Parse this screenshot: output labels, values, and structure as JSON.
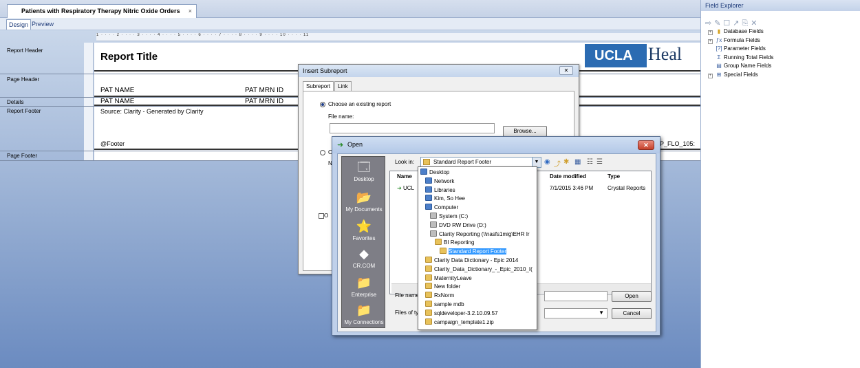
{
  "app": {
    "doc_tab": "Patients with Respiratory Therapy Nitric Oxide Orders",
    "doc_tab_close": "×",
    "mode_tabs": [
      "Design",
      "Preview"
    ]
  },
  "ruler": {
    "marks": "1 · · · · 2 · · · · 3 · · · · 4 · · · · 5 · · · · 6 · · · · 7 · · · · 8 · · · · 9 · · · · 10 · · · · 11"
  },
  "sections": [
    "Report Header",
    "Page Header",
    "Details",
    "Report Footer",
    "Page Footer"
  ],
  "report": {
    "title": "Report Title",
    "logo_text": "UCLA",
    "logo_suffix": "Heal",
    "page_header_fields": [
      "PAT NAME",
      "PAT MRN ID"
    ],
    "details_fields": [
      "PAT NAME",
      "PAT MRN ID"
    ],
    "footer_source": "Source: Clarity - Generated by Clarity",
    "footer_formula": "@Footer",
    "clipped_field": "P_FLO_105:"
  },
  "insert_subreport": {
    "title": "Insert Subreport",
    "close": "✕",
    "tabs": [
      "Subreport",
      "Link"
    ],
    "option_existing": "Choose an existing report",
    "file_name_label": "File name:",
    "file_name_value": "",
    "browse": "Browse...",
    "option_create_partial": "C",
    "option_partial_2": "N",
    "checkbox_partial": "O"
  },
  "open_dialog": {
    "title": "Open",
    "close": "✕",
    "look_in_label": "Look in:",
    "look_in_value": "Standard Report Footer",
    "places": [
      "Desktop",
      "My Documents",
      "Favorites",
      "CR.COM",
      "Enterprise",
      "My Connections"
    ],
    "columns": {
      "name": "Name",
      "date": "Date modified",
      "type": "Type"
    },
    "file_row": {
      "name": "UCL",
      "date": "7/1/2015 3:46 PM",
      "type": "Crystal Reports"
    },
    "file_name_label": "File name",
    "files_of_type_label": "Files of typ",
    "open_button": "Open",
    "cancel_button": "Cancel"
  },
  "look_in_dropdown": [
    {
      "label": "Desktop",
      "icon": "desktop-icon",
      "indent": 0
    },
    {
      "label": "Network",
      "icon": "network-icon",
      "indent": 1
    },
    {
      "label": "Libraries",
      "icon": "libraries-icon",
      "indent": 1
    },
    {
      "label": "Kim, So Hee",
      "icon": "user-icon",
      "indent": 1
    },
    {
      "label": "Computer",
      "icon": "computer-icon",
      "indent": 1
    },
    {
      "label": "System (C:)",
      "icon": "drive-icon",
      "indent": 2
    },
    {
      "label": "DVD RW Drive (D:)",
      "icon": "dvd-icon",
      "indent": 2
    },
    {
      "label": "Clarity Reporting (\\\\nasfs1mig\\EHR Ir",
      "icon": "network-drive-icon",
      "indent": 2
    },
    {
      "label": "BI Reporting",
      "icon": "folder-icon",
      "indent": 3
    },
    {
      "label": "Standard Report Footer",
      "icon": "folder-icon",
      "indent": 4,
      "selected": true
    },
    {
      "label": "Clarity Data Dictionary - Epic 2014",
      "icon": "folder-icon",
      "indent": 1
    },
    {
      "label": "Clarity_Data_Dictionary_-_Epic_2010_I(",
      "icon": "folder-icon",
      "indent": 1
    },
    {
      "label": "MaternityLeave",
      "icon": "folder-icon",
      "indent": 1
    },
    {
      "label": "New folder",
      "icon": "folder-icon",
      "indent": 1
    },
    {
      "label": "RxNorm",
      "icon": "folder-icon",
      "indent": 1
    },
    {
      "label": "sample mdb",
      "icon": "folder-icon",
      "indent": 1
    },
    {
      "label": "sqldeveloper-3.2.10.09.57",
      "icon": "folder-icon",
      "indent": 1
    },
    {
      "label": "campaign_template1.zip",
      "icon": "zip-folder-icon",
      "indent": 1
    }
  ],
  "field_explorer": {
    "title": "Field Explorer",
    "items": [
      {
        "label": "Database Fields",
        "icon": "database-icon"
      },
      {
        "label": "Formula Fields",
        "icon": "formula-icon"
      },
      {
        "label": "Parameter Fields",
        "icon": "parameter-icon"
      },
      {
        "label": "Running Total Fields",
        "icon": "running-total-icon"
      },
      {
        "label": "Group Name Fields",
        "icon": "group-name-icon"
      },
      {
        "label": "Special Fields",
        "icon": "special-fields-icon"
      }
    ]
  }
}
